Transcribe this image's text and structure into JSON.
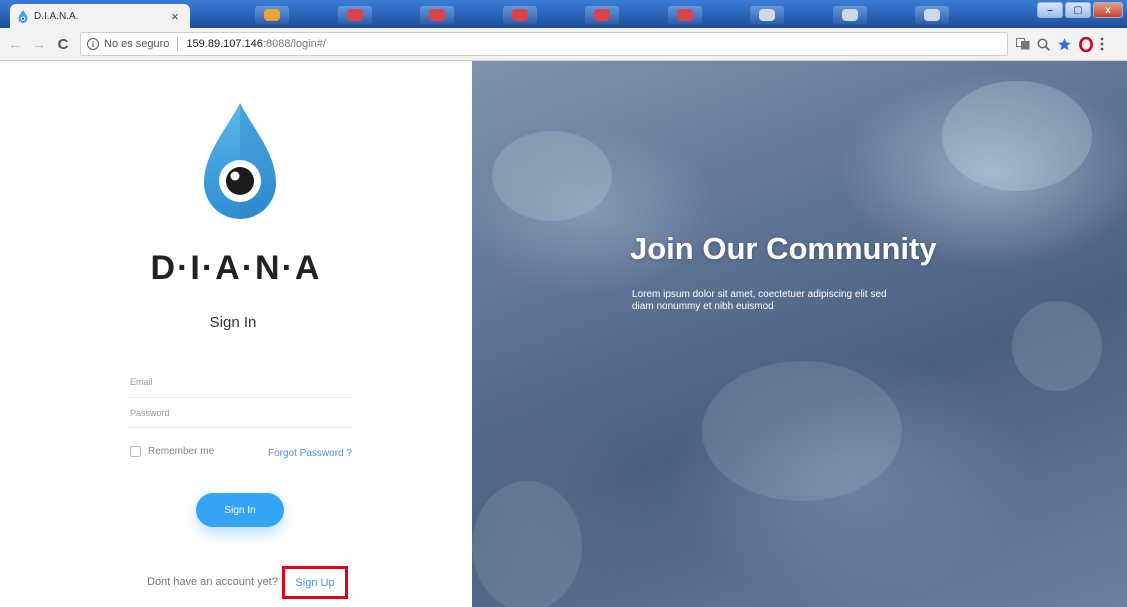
{
  "browser": {
    "tab_title": "D.I.A.N.A.",
    "tab_close": "×",
    "security_label": "No es seguro",
    "url_host": "159.89.107.146",
    "url_rest": ":8088/login#/",
    "info_glyph": "i",
    "back_glyph": "←",
    "forward_glyph": "→",
    "reload_glyph": "C",
    "window_controls": {
      "minimize": "–",
      "maximize": "▢",
      "close": "x"
    }
  },
  "login": {
    "brand": "D·I·A·N·A",
    "title": "Sign In",
    "email_label": "Email",
    "password_label": "Password",
    "remember_label": "Remember me",
    "forgot_label": "Forgot Password ?",
    "signin_button": "Sign In",
    "no_account_text": "Dont have an account yet?",
    "signup_link": "Sign Up"
  },
  "hero": {
    "title": "Join Our Community",
    "text": "Lorem ipsum dolor sit amet, coectetuer adipiscing elit sed diam nonummy et nibh euismod"
  },
  "colors": {
    "accent": "#35a4f5",
    "link": "#4a90e2",
    "highlight_box": "#e0001a",
    "drop": "#3fa3e0"
  },
  "icons": {
    "favicon": "drop-favicon-icon",
    "star": "star-icon",
    "opera": "opera-icon",
    "zoom": "zoom-icon",
    "translate": "translate-icon",
    "menu": "kebab-menu-icon"
  }
}
